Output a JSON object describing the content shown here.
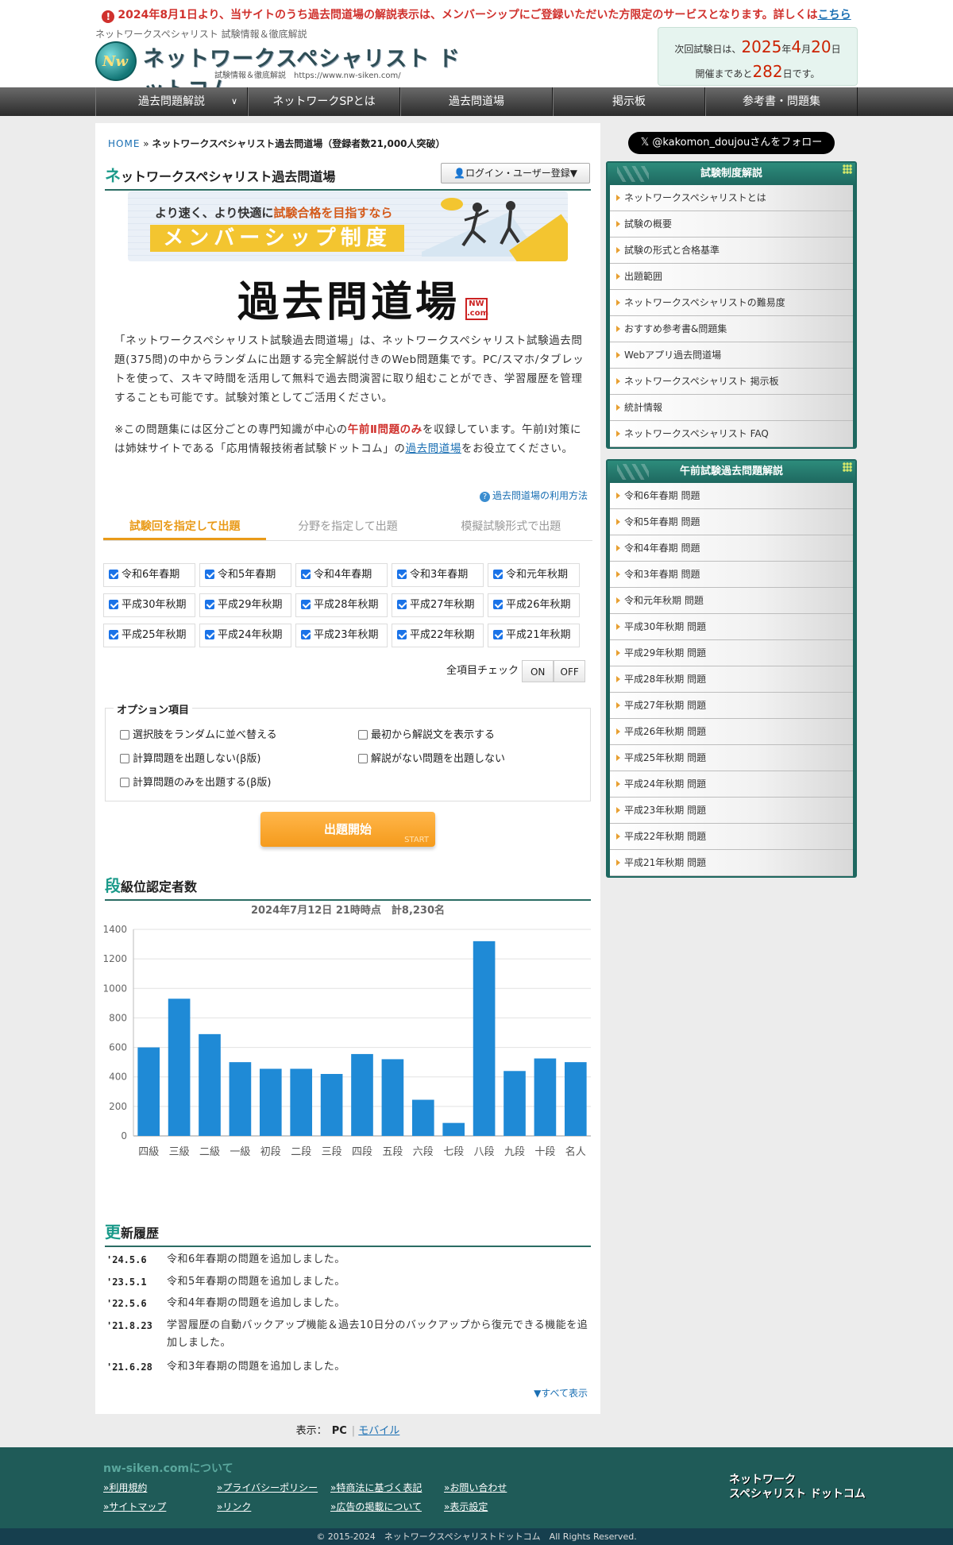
{
  "notice": {
    "text": "2024年8月1日より、当サイトのうち過去問道場の解説表示は、メンバーシップにご登録いただいた方限定のサービスとなります。詳しくは",
    "link": "こちら"
  },
  "header": {
    "tagline": "ネットワークスペシャリスト 試験情報＆徹底解説",
    "logo_title": "ネットワークスペシャリスト ドットコム",
    "logo_mark": "Nw",
    "logo_sub": "試験情報＆徹底解説　https://www.nw-siken.com/",
    "exam_line1_prefix": "次回試験日は、",
    "exam_year": "2025",
    "exam_year_suffix": "年",
    "exam_month": "4",
    "exam_month_suffix": "月",
    "exam_day": "20",
    "exam_day_suffix": "日",
    "exam_line2_prefix": "開催まであと",
    "days_left": "282",
    "days_suffix": "日です。"
  },
  "nav": {
    "items": [
      {
        "label": "過去問題解説",
        "chevron": "∨"
      },
      {
        "label": "ネットワークSPとは"
      },
      {
        "label": "過去問道場"
      },
      {
        "label": "掲示板"
      },
      {
        "label": "参考書・問題集"
      }
    ]
  },
  "breadcrumb": {
    "home": "HOME",
    "sep": "»",
    "current": "ネットワークスペシャリスト過去問道場（登録者数21,000人突破）"
  },
  "main": {
    "title_first": "ネ",
    "title_rest": "ットワークスペシャリスト過去問道場",
    "login": "ログイン・ユーザー登録▼",
    "banner_l1a": "より速く、より快適に",
    "banner_l1b": "試験合格を目指すなら",
    "banner_l2": "メンバーシップ制度",
    "brand": "過去問道場",
    "brand_badge": "NW .com",
    "para1": "「ネットワークスペシャリスト試験過去問道場」は、ネットワークスペシャリスト試験過去問題(375問)の中からランダムに出題する完全解説付きのWeb問題集です。PC/スマホ/タブレットを使って、スキマ時間を活用して無料で過去問演習に取り組むことができ、学習履歴を管理することも可能です。試験対策としてご活用ください。",
    "para2a": "※この問題集には区分ごとの専門知識が中心の",
    "para2b": "午前Ⅱ問題のみ",
    "para2c": "を収録しています。午前Ⅰ対策には姉妹サイトである「応用情報技術者試験ドットコム」の",
    "para2d": "過去問道場",
    "para2e": "をお役立てください。",
    "howto": "過去問道場の利用方法",
    "tabs": [
      "試験回を指定して出題",
      "分野を指定して出題",
      "模擬試験形式で出題"
    ],
    "exams": [
      "令和6年春期",
      "令和5年春期",
      "令和4年春期",
      "令和3年春期",
      "令和元年秋期",
      "平成30年秋期",
      "平成29年秋期",
      "平成28年秋期",
      "平成27年秋期",
      "平成26年秋期",
      "平成25年秋期",
      "平成24年秋期",
      "平成23年秋期",
      "平成22年秋期",
      "平成21年秋期"
    ],
    "allcheck_label": "全項目チェック",
    "on": "ON",
    "off": "OFF",
    "options_title": "オプション項目",
    "options": [
      "選択肢をランダムに並べ替える",
      "最初から解説文を表示する",
      "計算問題を出題しない(β版)",
      "解説がない問題を出題しない",
      "計算問題のみを出題する(β版)"
    ],
    "start": "出題開始",
    "start_en": "START",
    "rank_title_first": "段",
    "rank_title_rest": "級位認定者数",
    "history_title_first": "更",
    "history_title_rest": "新履歴",
    "history": [
      {
        "date": "'24.5.6",
        "text": "令和6年春期の問題を追加しました。"
      },
      {
        "date": "'23.5.1",
        "text": "令和5年春期の問題を追加しました。"
      },
      {
        "date": "'22.5.6",
        "text": "令和4年春期の問題を追加しました。"
      },
      {
        "date": "'21.8.23",
        "text": "学習履歴の自動バックアップ機能＆過去10日分のバックアップから復元できる機能を追加しました。"
      },
      {
        "date": "'21.6.28",
        "text": "令和3年春期の問題を追加しました。"
      }
    ],
    "more": "▼すべて表示"
  },
  "view": {
    "label": "表示：",
    "pc": "PC",
    "sep": "|",
    "mobile": "モバイル"
  },
  "sidebar": {
    "follow": "@kakomon_doujouさんをフォロー",
    "box1_title": "試験制度解説",
    "box1_items": [
      "ネットワークスペシャリストとは",
      "試験の概要",
      "試験の形式と合格基準",
      "出題範囲",
      "ネットワークスペシャリストの難易度",
      "おすすめ参考書&問題集",
      "Webアプリ過去問道場",
      "ネットワークスペシャリスト 掲示板",
      "統計情報",
      "ネットワークスペシャリスト FAQ"
    ],
    "box2_title": "午前試験過去問題解説",
    "box2_items": [
      "令和6年春期 問題",
      "令和5年春期 問題",
      "令和4年春期 問題",
      "令和3年春期 問題",
      "令和元年秋期 問題",
      "平成30年秋期 問題",
      "平成29年秋期 問題",
      "平成28年秋期 問題",
      "平成27年秋期 問題",
      "平成26年秋期 問題",
      "平成25年秋期 問題",
      "平成24年秋期 問題",
      "平成23年秋期 問題",
      "平成22年秋期 問題",
      "平成21年秋期 問題"
    ]
  },
  "footer": {
    "about": "nw-siken.comについて",
    "links": [
      "»利用規約",
      "»プライバシーポリシー",
      "»特商法に基づく表記",
      "»お問い合わせ",
      "»サイトマップ",
      "»リンク",
      "»広告の掲載について",
      "»表示設定"
    ],
    "logo_l1": "ネットワーク",
    "logo_l2": "スペシャリスト ドットコム",
    "copyright": "© 2015-2024　ネットワークスペシャリストドットコム　All Rights Reserved."
  },
  "colors": {
    "accent": "#1e6860",
    "orange": "#f59b1c",
    "bar": "#1f8ad6",
    "red": "#d0312d"
  },
  "chart_data": {
    "type": "bar",
    "title": "2024年7月12日 21時時点　計8,230名",
    "categories": [
      "四級",
      "三級",
      "二級",
      "一級",
      "初段",
      "二段",
      "三段",
      "四段",
      "五段",
      "六段",
      "七段",
      "八段",
      "九段",
      "十段",
      "名人"
    ],
    "values": [
      600,
      930,
      690,
      500,
      455,
      455,
      420,
      555,
      520,
      245,
      88,
      1320,
      440,
      525,
      500
    ],
    "ylim": [
      0,
      1400
    ],
    "yticks": [
      0,
      200,
      400,
      600,
      800,
      1000,
      1200,
      1400
    ],
    "grid": true,
    "xlabel": "",
    "ylabel": ""
  }
}
